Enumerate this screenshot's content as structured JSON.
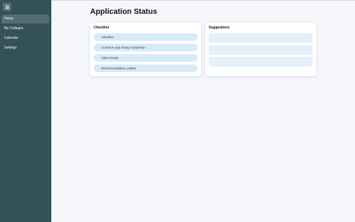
{
  "sidebar": {
    "menu_icon": "hamburger-menu-icon",
    "bg_color": "#335157",
    "items": [
      {
        "label": "Home",
        "active": true
      },
      {
        "label": "My Colleges"
      },
      {
        "label": "Calendar"
      },
      {
        "label": "Settings"
      }
    ]
  },
  "main": {
    "title": "Application Status",
    "checklist": {
      "title": "Checklist",
      "items": [
        {
          "label": "Activities"
        },
        {
          "label": "Common App Essay completion"
        },
        {
          "label": "Video Essay"
        },
        {
          "label": "Recommendation Letters"
        }
      ]
    },
    "suggestions": {
      "title": "Suggestions",
      "item_count_placeholders": [
        "",
        "",
        ""
      ]
    }
  }
}
